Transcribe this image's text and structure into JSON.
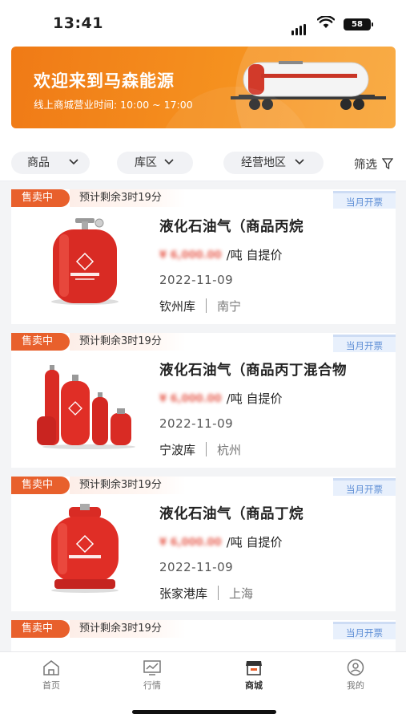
{
  "status_bar": {
    "time": "13:41",
    "battery": "58"
  },
  "banner": {
    "title": "欢迎来到马森能源",
    "subtitle": "线上商城营业时间: 10:00 ~ 17:00",
    "colors": {
      "start": "#f07a16",
      "end": "#f9a12c"
    }
  },
  "filters": {
    "product": "商品",
    "warehouse": "库区",
    "region": "经营地区",
    "filter": "筛选"
  },
  "products": [
    {
      "status": "售卖中",
      "countdown": "预计剩余3时19分",
      "invoice": "当月开票",
      "name": "液化石油气（商品丙烷",
      "price_masked": "¥ 6,000.00",
      "unit": "/吨 自提价",
      "date": "2022-11-09",
      "warehouse": "钦州库",
      "city": "南宁",
      "image_icon": "propane-cylinder-icon"
    },
    {
      "status": "售卖中",
      "countdown": "预计剩余3时19分",
      "invoice": "当月开票",
      "name": "液化石油气（商品丙丁混合物",
      "price_masked": "¥ 6,000.00",
      "unit": "/吨 自提价",
      "date": "2022-11-09",
      "warehouse": "宁波库",
      "city": "杭州",
      "image_icon": "gas-cylinders-group-icon"
    },
    {
      "status": "售卖中",
      "countdown": "预计剩余3时19分",
      "invoice": "当月开票",
      "name": "液化石油气（商品丁烷",
      "price_masked": "¥ 6,000.00",
      "unit": "/吨 自提价",
      "date": "2022-11-09",
      "warehouse": "张家港库",
      "city": "上海",
      "image_icon": "lpg-tank-icon"
    },
    {
      "status": "售卖中",
      "countdown": "预计剩余3时19分",
      "invoice": "当月开票",
      "name": "",
      "price_masked": "",
      "unit": "",
      "date": "",
      "warehouse": "",
      "city": "",
      "image_icon": ""
    }
  ],
  "tabbar": {
    "items": [
      {
        "label": "首页",
        "icon": "home-icon"
      },
      {
        "label": "行情",
        "icon": "market-chart-icon"
      },
      {
        "label": "商城",
        "icon": "store-icon",
        "active": true
      },
      {
        "label": "我的",
        "icon": "profile-icon"
      }
    ]
  },
  "colors": {
    "sell_badge": "#e8602c",
    "invoice_text": "#5f8fd6",
    "price": "#e0301e"
  }
}
